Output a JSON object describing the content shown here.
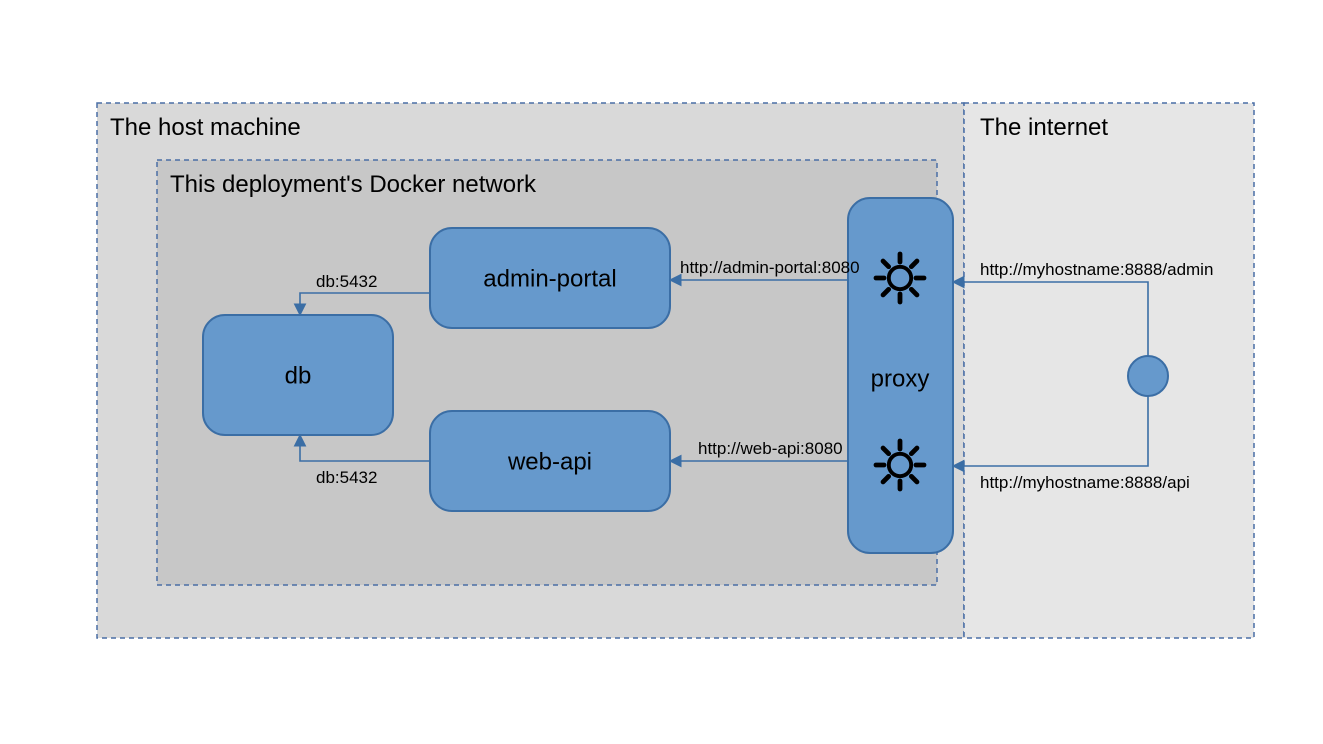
{
  "diagram": {
    "zones": {
      "host": "The host machine",
      "docker": "This deployment's Docker network",
      "internet": "The internet"
    },
    "nodes": {
      "db": "db",
      "adminPortal": "admin-portal",
      "webApi": "web-api",
      "proxy": "proxy"
    },
    "edges": {
      "adminToDb": "db:5432",
      "webToDb": "db:5432",
      "proxyToAdmin": "http://admin-portal:8080",
      "proxyToWeb": "http://web-api:8080",
      "internetToAdmin": "http://myhostname:8888/admin",
      "internetToApi": "http://myhostname:8888/api"
    },
    "colors": {
      "nodeFill": "#6699cc",
      "nodeStroke": "#3b6ea5",
      "zoneHost": "#d9d9d9",
      "zoneDocker": "#c7c7c7",
      "zoneInternet": "#e6e6e6",
      "zoneBorder": "#4a6fa5"
    }
  }
}
